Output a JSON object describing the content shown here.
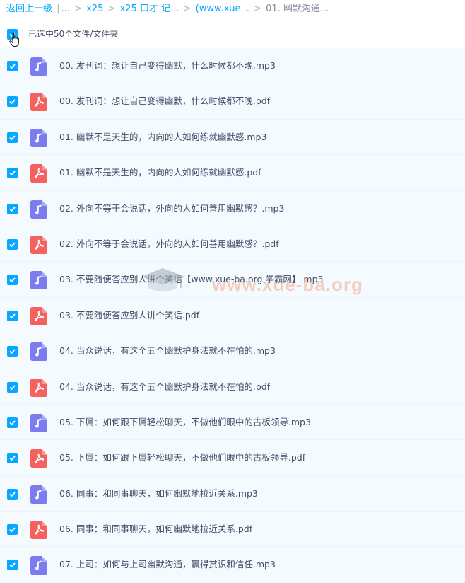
{
  "breadcrumb": {
    "back": "返回上一级",
    "sep1": "|",
    "ellipsis": "...",
    "items": [
      "x25",
      "x25 口才 记...",
      "(www.xue..."
    ],
    "current": "01. 幽默沟通..."
  },
  "selection": {
    "text": "已选中50个文件/文件夹"
  },
  "files": [
    {
      "type": "mp3",
      "name": "00. 发刊词：想让自己变得幽默，什么时候都不晚.mp3"
    },
    {
      "type": "pdf",
      "name": "00. 发刊词：想让自己变得幽默，什么时候都不晚.pdf"
    },
    {
      "type": "mp3",
      "name": "01. 幽默不是天生的，内向的人如何练就幽默感.mp3"
    },
    {
      "type": "pdf",
      "name": "01. 幽默不是天生的，内向的人如何练就幽默感.pdf"
    },
    {
      "type": "mp3",
      "name": "02. 外向不等于会说话，外向的人如何善用幽默感？.mp3"
    },
    {
      "type": "pdf",
      "name": "02. 外向不等于会说话，外向的人如何善用幽默感？.pdf"
    },
    {
      "type": "mp3",
      "name": "03. 不要随便答应别人讲个笑话【www.xue-ba.org 学霸网】.mp3"
    },
    {
      "type": "pdf",
      "name": "03. 不要随便答应别人讲个笑话.pdf"
    },
    {
      "type": "mp3",
      "name": "04. 当众说话，有这个五个幽默护身法就不在怕的.mp3"
    },
    {
      "type": "pdf",
      "name": "04. 当众说话，有这个五个幽默护身法就不在怕的.pdf"
    },
    {
      "type": "mp3",
      "name": "05. 下属：如何跟下属轻松聊天，不做他们眼中的古板领导.mp3"
    },
    {
      "type": "pdf",
      "name": "05. 下属：如何跟下属轻松聊天，不做他们眼中的古板领导.pdf"
    },
    {
      "type": "mp3",
      "name": "06. 同事：和同事聊天，如何幽默地拉近关系.mp3"
    },
    {
      "type": "pdf",
      "name": "06. 同事：和同事聊天，如何幽默地拉近关系.pdf"
    },
    {
      "type": "mp3",
      "name": "07. 上司：如何与上司幽默沟通，赢得赏识和信任.mp3"
    }
  ],
  "watermark": "www.xue-ba.org",
  "colors": {
    "accent": "#06a7ff",
    "mp3": "#7b7cf0",
    "pdf": "#f5615e"
  }
}
